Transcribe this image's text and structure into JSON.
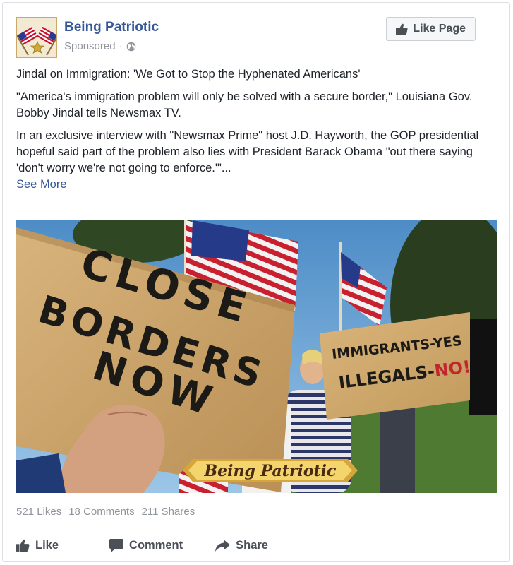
{
  "post": {
    "page_name": "Being Patriotic",
    "sponsored": "Sponsored",
    "sponsored_sep": "·",
    "like_page_label": "Like Page",
    "headline": "Jindal on Immigration: 'We Got to Stop the Hyphenated Americans'",
    "paragraph1": "\"America's immigration problem will only be solved with a secure border,\" Louisiana Gov. Bobby Jindal tells Newsmax TV.",
    "paragraph2": "In an exclusive interview with \"Newsmax Prime\" host J.D. Hayworth, the GOP presidential hopeful said part of the problem also lies with President Barack Obama \"out there saying 'don't worry we're not going to enforce.'\"...",
    "see_more": "See More"
  },
  "image": {
    "sign1_line1": "CLOSE",
    "sign1_line2": "BORDERS",
    "sign1_line3": "NOW",
    "sign2_line1": "IMMIGRANTS-YES",
    "sign2_line2a": "ILLEGALS-",
    "sign2_line2b": "NO!",
    "watermark": "Being Patriotic"
  },
  "stats": {
    "likes": "521 Likes",
    "comments": "18 Comments",
    "shares": "211 Shares"
  },
  "actions": {
    "like": "Like",
    "comment": "Comment",
    "share": "Share"
  },
  "colors": {
    "link_blue": "#365899",
    "meta_gray": "#90949c",
    "cardboard": "#c9a26b"
  },
  "icons": {
    "avatar": "crossed-flags-icon",
    "privacy": "globe-icon",
    "like": "thumbs-up-icon",
    "comment": "comment-bubble-icon",
    "share": "share-arrow-icon"
  }
}
